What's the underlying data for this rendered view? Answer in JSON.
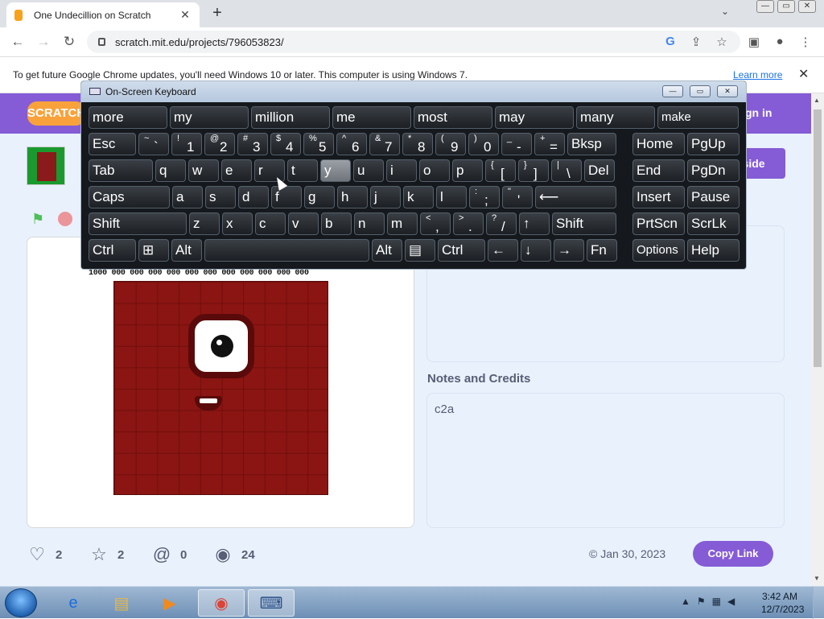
{
  "browser": {
    "tab_title": "One Undecillion on Scratch",
    "tab_close": "✕",
    "new_tab": "+",
    "tab_dropdown": "⌄",
    "url": "scratch.mit.edu/projects/796053823/",
    "window_buttons": [
      "—",
      "▭",
      "✕"
    ]
  },
  "infobar": {
    "message": "To get future Google Chrome updates, you'll need Windows 10 or later. This computer is using Windows 7.",
    "learn_more": "Learn more",
    "close": "✕"
  },
  "scratch": {
    "logo": "SCRATCH",
    "sign_in": "gn in",
    "see_inside": "nside",
    "big_number": "1000 000 000 000 000 000 000 000 000 000 000 000",
    "notes_heading": "Notes and Credits",
    "notes_text": "c2a",
    "stats": {
      "loves": "2",
      "favorites": "2",
      "remixes": "0",
      "views": "24"
    },
    "date": "© Jan 30, 2023",
    "copy_link": "Copy Link"
  },
  "osk": {
    "title": "On-Screen Keyboard",
    "predictions": [
      "more",
      "my",
      "million",
      "me",
      "most",
      "may",
      "many",
      "make"
    ],
    "row1": [
      {
        "label": "Esc"
      },
      {
        "sup": "~",
        "main": "`"
      },
      {
        "sup": "!",
        "main": "1"
      },
      {
        "sup": "@",
        "main": "2"
      },
      {
        "sup": "#",
        "main": "3"
      },
      {
        "sup": "$",
        "main": "4"
      },
      {
        "sup": "%",
        "main": "5"
      },
      {
        "sup": "^",
        "main": "6"
      },
      {
        "sup": "&",
        "main": "7"
      },
      {
        "sup": "*",
        "main": "8"
      },
      {
        "sup": "(",
        "main": "9"
      },
      {
        "sup": ")",
        "main": "0"
      },
      {
        "sup": "_",
        "main": "-"
      },
      {
        "sup": "+",
        "main": "="
      },
      {
        "label": "Bksp"
      },
      {
        "label": "Home"
      },
      {
        "label": "PgUp"
      }
    ],
    "row2": [
      "Tab",
      "q",
      "w",
      "e",
      "r",
      "t",
      "y",
      "u",
      "i",
      "o",
      "p",
      "[",
      "]",
      "\\",
      "Del",
      "End",
      "PgDn"
    ],
    "row2_sup": {
      "[": "{",
      "]": "}",
      "\\": "|"
    },
    "row3": [
      "Caps",
      "a",
      "s",
      "d",
      "f",
      "g",
      "h",
      "j",
      "k",
      "l",
      ";",
      "'",
      "⟵",
      "Insert",
      "Pause"
    ],
    "row3_sup": {
      ";": ":",
      "'": "\""
    },
    "row4": [
      "Shift",
      "z",
      "x",
      "c",
      "v",
      "b",
      "n",
      "m",
      ",",
      ".",
      "/",
      "↑",
      "Shift",
      "PrtScn",
      "ScrLk"
    ],
    "row4_sup": {
      ",": "<",
      ".": ">",
      "/": "?"
    },
    "row5": [
      "Ctrl",
      "⊞",
      "Alt",
      "",
      "Alt",
      "▤",
      "Ctrl",
      "←",
      "↓",
      "→",
      "Fn",
      "Options",
      "Help"
    ],
    "pressed_key": "y"
  },
  "taskbar": {
    "time": "3:42 AM",
    "date": "12/7/2023"
  }
}
